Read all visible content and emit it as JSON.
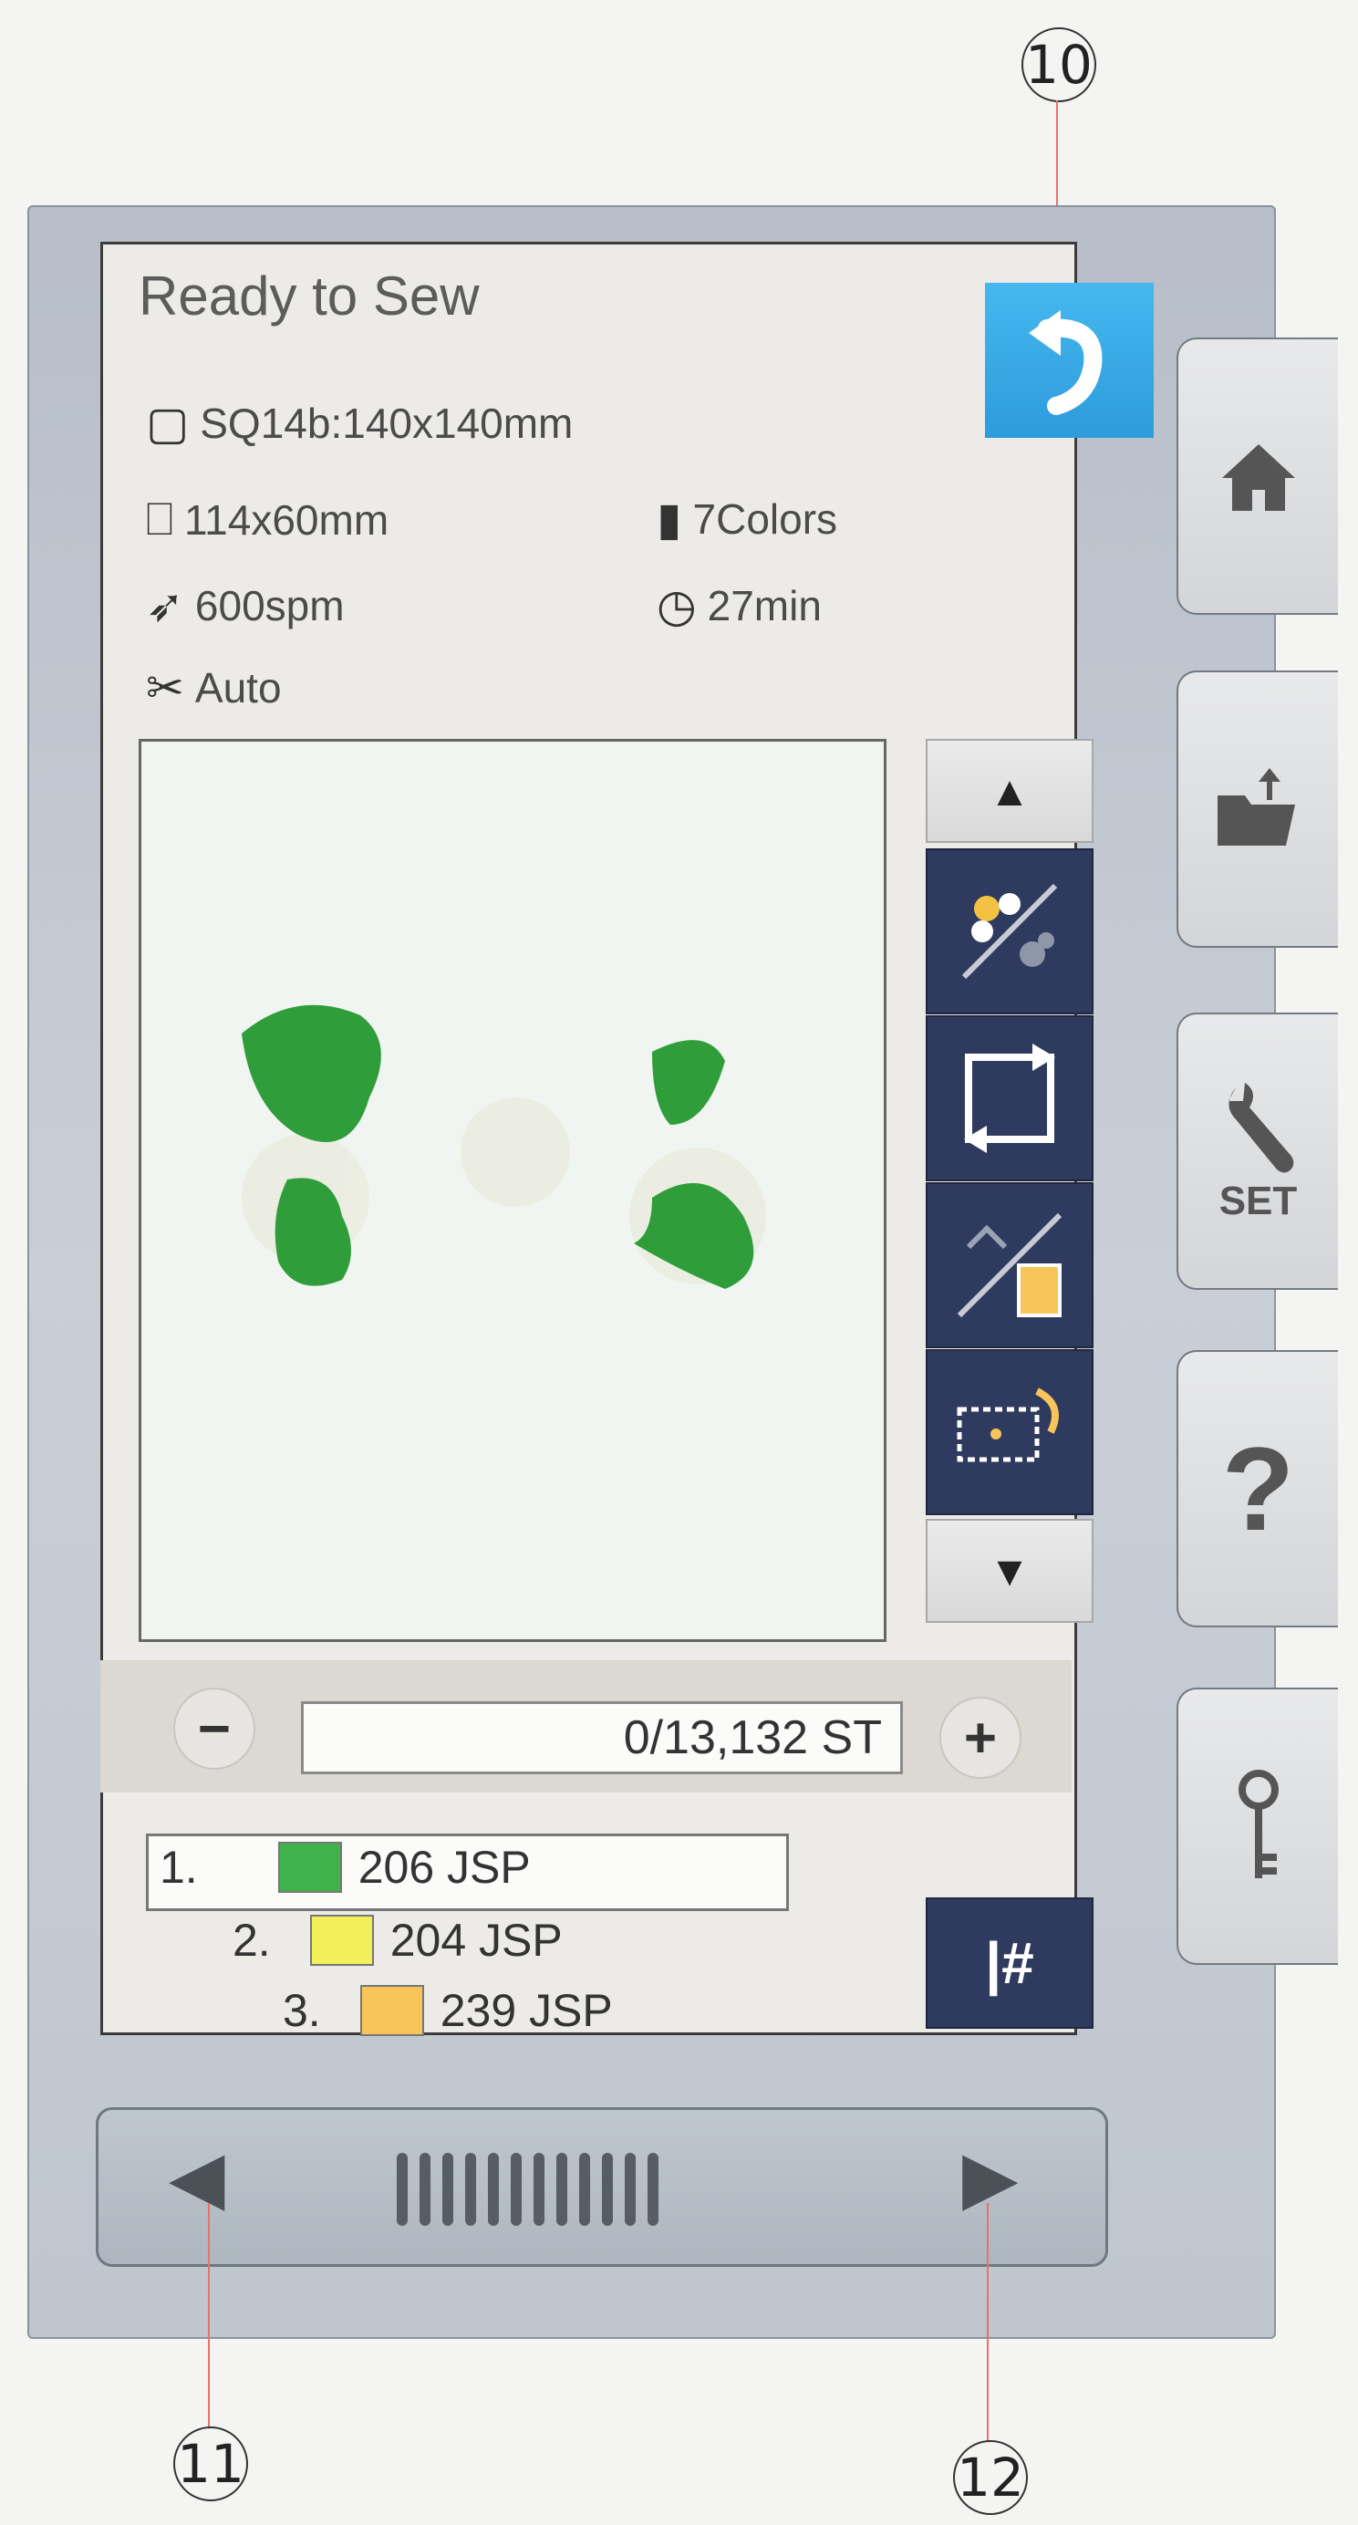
{
  "callouts": {
    "top": "10",
    "left": "11",
    "right": "12"
  },
  "screen": {
    "status_title": "Ready to Sew",
    "hoop": "SQ14b:140x140mm",
    "design_size": "114x60mm",
    "colors": "7Colors",
    "speed": "600spm",
    "time": "27min",
    "thread_cut": "Auto"
  },
  "counter": {
    "minus": "−",
    "plus": "+",
    "value": "0/13,132 ST"
  },
  "threads": [
    {
      "num": "1.",
      "name": "206 JSP",
      "color": "#3fb24a"
    },
    {
      "num": "2.",
      "name": "204 JSP",
      "color": "#f2f05a"
    },
    {
      "num": "3.",
      "name": "239 JSP",
      "color": "#f7c55a"
    }
  ],
  "tools": {
    "needle_label": "|#"
  },
  "side_tabs": {
    "set_label": "SET",
    "help_label": "?"
  },
  "icons": [
    "back-icon",
    "hoop-icon",
    "design-size-icon",
    "spool-icon",
    "speed-icon",
    "clock-icon",
    "thread-cut-icon",
    "up-arrow-icon",
    "color-trim-icon",
    "trace-icon",
    "jump-icon",
    "rotate-icon",
    "down-arrow-icon",
    "home-icon",
    "folder-icon",
    "wrench-icon",
    "help-icon",
    "key-icon",
    "left-triangle-icon",
    "right-triangle-icon"
  ]
}
